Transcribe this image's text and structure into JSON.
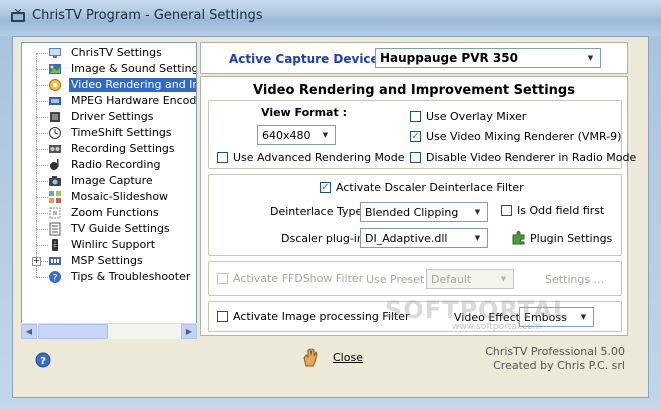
{
  "window": {
    "title": "ChrisTV Program - General Settings"
  },
  "sidebar": {
    "items": [
      {
        "label": "ChrisTV Settings",
        "icon": "monitor-icon"
      },
      {
        "label": "Image & Sound Settings",
        "icon": "image-sound-icon"
      },
      {
        "label": "Video Rendering and Improve",
        "icon": "video-render-icon",
        "selected": true
      },
      {
        "label": "MPEG Hardware Encoding",
        "icon": "mpeg-icon"
      },
      {
        "label": "Driver Settings",
        "icon": "driver-icon"
      },
      {
        "label": "TimeShift Settings",
        "icon": "timeshift-icon"
      },
      {
        "label": "Recording Settings",
        "icon": "recording-icon"
      },
      {
        "label": "Radio Recording",
        "icon": "radio-icon"
      },
      {
        "label": "Image Capture",
        "icon": "camera-icon"
      },
      {
        "label": "Mosaic-Slideshow",
        "icon": "mosaic-icon"
      },
      {
        "label": "Zoom Functions",
        "icon": "zoom-icon"
      },
      {
        "label": "TV Guide Settings",
        "icon": "tv-guide-icon"
      },
      {
        "label": "Winlirc Support",
        "icon": "remote-icon"
      },
      {
        "label": "MSP Settings",
        "icon": "msp-icon",
        "expandable": true
      },
      {
        "label": "Tips & Troubleshooter",
        "icon": "tips-icon"
      }
    ]
  },
  "capture": {
    "label": "Active Capture Device :",
    "device": "Hauppauge PVR 350"
  },
  "panel": {
    "title": "Video Rendering and Improvement Settings"
  },
  "render": {
    "view_format_label": "View Format :",
    "view_format_value": "640x480",
    "use_advanced": "Use Advanced Rendering Mode",
    "use_overlay": "Use Overlay Mixer",
    "use_vmr9": "Use Video Mixing Renderer (VMR-9)",
    "disable_radio": "Disable Video Renderer in Radio Mode"
  },
  "dscaler": {
    "activate": "Activate Dscaler Deinterlace Filter",
    "deinterlace_label": "Deinterlace Type :",
    "deinterlace_value": "Blended Clipping",
    "is_odd": "Is Odd field first",
    "plugin_label": "Dscaler plug-in :",
    "plugin_value": "DI_Adaptive.dll",
    "plugin_settings": "Plugin Settings"
  },
  "ffdshow": {
    "activate": "Activate FFDShow Filter",
    "preset_label": "Use Preset :",
    "preset_value": "Default",
    "settings": "Settings ..."
  },
  "imageproc": {
    "activate": "Activate Image processing Filter",
    "effect_label": "Video Effect :",
    "effect_value": "Emboss"
  },
  "footer": {
    "close_label": "Close",
    "version": "ChrisTV Professional 5.00",
    "credit": "Created by Chris P.C. srl"
  },
  "watermark": {
    "text": "SOFTPORTAL",
    "url": "www.softportal.com"
  },
  "colors": {
    "accent": "#1f3fa8",
    "selection": "#316ac5",
    "check": "#21a121"
  }
}
